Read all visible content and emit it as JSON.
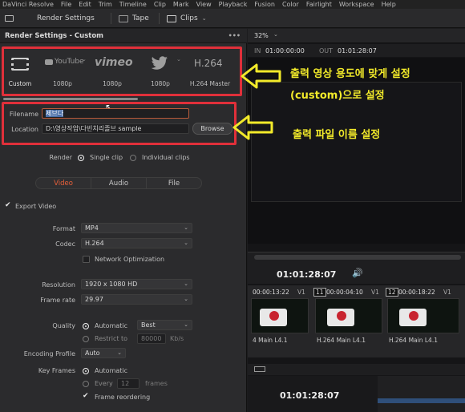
{
  "menubar": {
    "items": [
      "DaVinci Resolve",
      "File",
      "Edit",
      "Trim",
      "Timeline",
      "Clip",
      "Mark",
      "View",
      "Playback",
      "Fusion",
      "Color",
      "Fairlight",
      "Workspace",
      "Help"
    ]
  },
  "toolbar": {
    "render_settings": "Render Settings",
    "tape": "Tape",
    "clips": "Clips"
  },
  "panel": {
    "title": "Render Settings - Custom",
    "more": "•••"
  },
  "presets": [
    {
      "label": "Custom",
      "logo": "film-icon"
    },
    {
      "label": "1080p",
      "logo": "YouTube"
    },
    {
      "label": "1080p",
      "logo": "vimeo"
    },
    {
      "label": "1080p",
      "logo": "twitter-bird-icon"
    },
    {
      "label": "H.264 Master",
      "logo": "H.264"
    }
  ],
  "file": {
    "filename_label": "Filename",
    "filename_value": "제브다",
    "location_label": "Location",
    "location_value": "D:\\영상작업\\다빈치리졸브 sample",
    "browse": "Browse"
  },
  "render": {
    "label": "Render",
    "single": "Single clip",
    "individual": "Individual clips"
  },
  "tabs": [
    "Video",
    "Audio",
    "File"
  ],
  "video": {
    "export_video": "Export Video",
    "format_label": "Format",
    "format_value": "MP4",
    "codec_label": "Codec",
    "codec_value": "H.264",
    "network_opt": "Network Optimization",
    "resolution_label": "Resolution",
    "resolution_value": "1920 x 1080 HD",
    "framerate_label": "Frame rate",
    "framerate_value": "29.97",
    "quality_label": "Quality",
    "automatic": "Automatic",
    "quality_value": "Best",
    "restrict_to": "Restrict to",
    "restrict_value": "80000",
    "restrict_unit": "Kb/s",
    "encoding_profile_label": "Encoding Profile",
    "encoding_profile_value": "Auto",
    "keyframes_label": "Key Frames",
    "keyframes_auto": "Automatic",
    "every": "Every",
    "every_value": "12",
    "frames": "frames",
    "frame_reordering": "Frame reordering"
  },
  "annotations": {
    "top_line1": "출력 영상 용도에 맞게 설정",
    "top_line2": "(custom)으로 설정",
    "middle": "출력 파일 이름 설정"
  },
  "viewer": {
    "zoom": "32%",
    "in_label": "IN",
    "in_value": "01:00:00:00",
    "out_label": "OUT",
    "out_value": "01:01:28:07",
    "timecode": "01:01:28:07",
    "bottom_timecode": "01:01:28:07"
  },
  "clips": [
    {
      "time": "00:00:13:22",
      "track": "V1",
      "label": "4 Main L4.1"
    },
    {
      "num": "11",
      "time": "00:00:04:10",
      "track": "V1",
      "label": "H.264 Main L4.1"
    },
    {
      "num": "12",
      "time": "00:00:18:22",
      "track": "V1",
      "label": "H.264 Main L4.1"
    }
  ],
  "colors": {
    "annotation": "#f2ea2a",
    "highlight_box": "#e0303a",
    "active_tab": "#e8603a"
  }
}
